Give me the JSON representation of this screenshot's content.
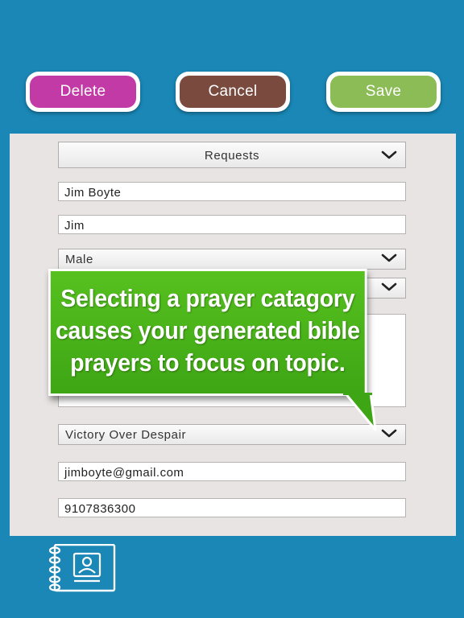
{
  "toolbar": {
    "delete_label": "Delete",
    "cancel_label": "Cancel",
    "save_label": "Save"
  },
  "form": {
    "request_type": "Requests",
    "full_name": "Jim Boyte",
    "nickname": "Jim",
    "gender": "Male",
    "prayer_category": "Victory Over Despair",
    "email": "jimboyte@gmail.com",
    "phone": "9107836300"
  },
  "callout": {
    "line1": "Selecting a prayer catagory",
    "line2": "causes your generated bible",
    "line3": "prayers to focus on topic."
  },
  "icons": {
    "chevron": "chevron-down-icon",
    "contacts": "address-book-icon"
  },
  "colors": {
    "background": "#1a87b6",
    "delete": "#c23aa5",
    "cancel": "#7a4a3e",
    "save": "#8cbc55",
    "callout": "#4cb31a"
  }
}
